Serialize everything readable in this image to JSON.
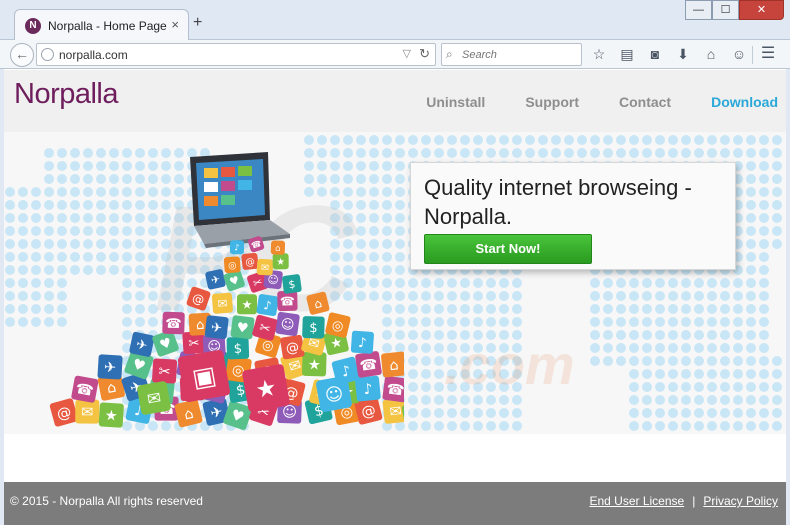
{
  "browser": {
    "tab_title": "Norpalla - Home Page",
    "tab_favicon_letter": "N",
    "tab_close": "×",
    "new_tab": "+",
    "window_buttons": [
      "—",
      "☐",
      "✕"
    ],
    "url": "norpalla.com",
    "search_placeholder": "Search",
    "toolbar_icons": [
      "star-icon",
      "reading-list-icon",
      "pocket-icon",
      "download-icon",
      "home-icon",
      "chat-icon"
    ],
    "menu_icon": "hamburger-menu-icon"
  },
  "site": {
    "logo": "Norpalla",
    "nav": [
      "Uninstall",
      "Support",
      "Contact",
      "Download"
    ],
    "promo_text": "Quality internet browseing - Norpalla.",
    "start_button": "Start Now!",
    "copyright": "© 2015 - Norpalla All rights reserved",
    "footer_links": [
      "End User License",
      "Privacy Policy"
    ],
    "footer_sep": "|"
  },
  "colors": {
    "logo": "#6e1e5d",
    "download_link": "#2aa8d8",
    "start_button": "#3cb42f",
    "footer": "#7c7c7c",
    "map_dots": "#c9e6f6"
  }
}
